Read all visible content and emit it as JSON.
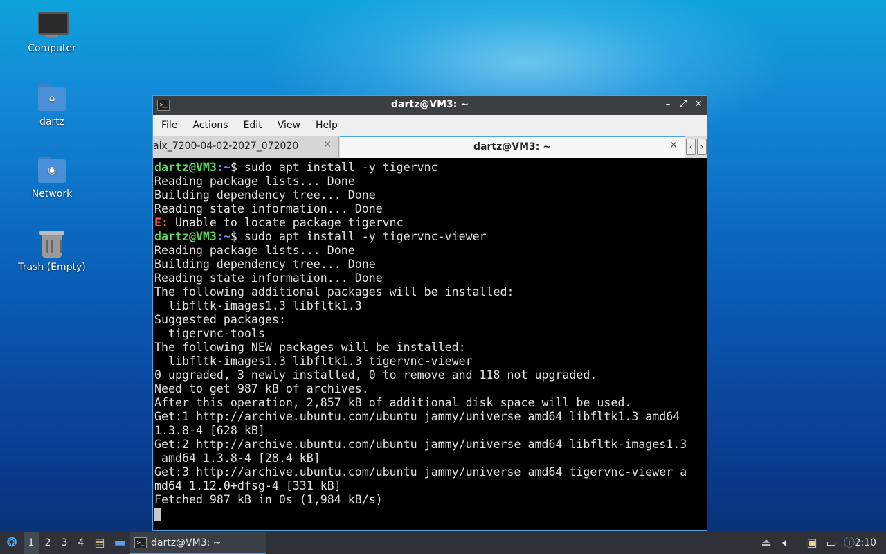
{
  "desktop": {
    "icons": [
      {
        "label": "Computer"
      },
      {
        "label": "dartz"
      },
      {
        "label": "Network"
      },
      {
        "label": "Trash (Empty)"
      }
    ]
  },
  "window": {
    "title": "dartz@VM3: ~",
    "menu": [
      "File",
      "Actions",
      "Edit",
      "View",
      "Help"
    ],
    "tabs": [
      {
        "label": "aix_7200-04-02-2027_072020",
        "active": false
      },
      {
        "label": "dartz@VM3: ~",
        "active": true
      }
    ]
  },
  "terminal": {
    "prompt_user": "dartz@VM3",
    "prompt_path": ":~",
    "prompt_symbol": "$",
    "lines": [
      {
        "kind": "prompt",
        "cmd": " sudo apt install -y tigervnc"
      },
      {
        "kind": "out",
        "text": "Reading package lists... Done"
      },
      {
        "kind": "out",
        "text": "Building dependency tree... Done"
      },
      {
        "kind": "out",
        "text": "Reading state information... Done"
      },
      {
        "kind": "error",
        "tag": "E:",
        "text": " Unable to locate package tigervnc"
      },
      {
        "kind": "prompt",
        "cmd": " sudo apt install -y tigervnc-viewer"
      },
      {
        "kind": "out",
        "text": "Reading package lists... Done"
      },
      {
        "kind": "out",
        "text": "Building dependency tree... Done"
      },
      {
        "kind": "out",
        "text": "Reading state information... Done"
      },
      {
        "kind": "out",
        "text": "The following additional packages will be installed:"
      },
      {
        "kind": "out",
        "text": "  libfltk-images1.3 libfltk1.3"
      },
      {
        "kind": "out",
        "text": "Suggested packages:"
      },
      {
        "kind": "out",
        "text": "  tigervnc-tools"
      },
      {
        "kind": "out",
        "text": "The following NEW packages will be installed:"
      },
      {
        "kind": "out",
        "text": "  libfltk-images1.3 libfltk1.3 tigervnc-viewer"
      },
      {
        "kind": "out",
        "text": "0 upgraded, 3 newly installed, 0 to remove and 118 not upgraded."
      },
      {
        "kind": "out",
        "text": "Need to get 987 kB of archives."
      },
      {
        "kind": "out",
        "text": "After this operation, 2,857 kB of additional disk space will be used."
      },
      {
        "kind": "out",
        "text": "Get:1 http://archive.ubuntu.com/ubuntu jammy/universe amd64 libfltk1.3 amd64"
      },
      {
        "kind": "out",
        "text": "1.3.8-4 [628 kB]"
      },
      {
        "kind": "out",
        "text": "Get:2 http://archive.ubuntu.com/ubuntu jammy/universe amd64 libfltk-images1.3"
      },
      {
        "kind": "out",
        "text": " amd64 1.3.8-4 [28.4 kB]"
      },
      {
        "kind": "out",
        "text": "Get:3 http://archive.ubuntu.com/ubuntu jammy/universe amd64 tigervnc-viewer a"
      },
      {
        "kind": "out",
        "text": "md64 1.12.0+dfsg-4 [331 kB]"
      },
      {
        "kind": "out",
        "text": "Fetched 987 kB in 0s (1,984 kB/s)"
      },
      {
        "kind": "cursor"
      }
    ]
  },
  "taskbar": {
    "workspaces": [
      "1",
      "2",
      "3",
      "4"
    ],
    "active_workspace": "1",
    "task_label": "dartz@VM3: ~",
    "clock": "2:10"
  },
  "icons": {
    "start": "start-menu-icon",
    "terminal": "terminal-icon",
    "file_manager": "file-manager-icon",
    "show_desktop": "show-desktop-icon",
    "volume": "volume-icon",
    "clipboard": "clipboard-icon",
    "network": "network-icon",
    "notification": "notification-icon",
    "minimize": "minimize-icon",
    "maximize": "maximize-icon",
    "close": "close-icon"
  },
  "colors": {
    "accent": "#4aa3e8",
    "prompt_user": "#5fd35f",
    "prompt_path": "#5c8fe0",
    "error": "#ff5555"
  }
}
